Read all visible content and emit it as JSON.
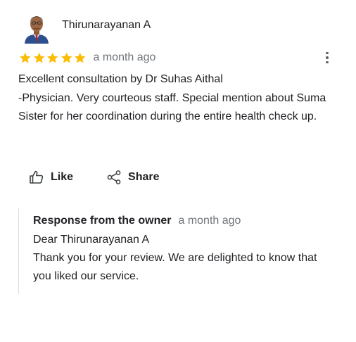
{
  "review": {
    "reviewer_name": "Thirunarayanan A",
    "rating": 5,
    "rating_max": 5,
    "timestamp": "a month ago",
    "text": "Excellent consultation by Dr Suhas Aithal\n-Physician. Very courteous staff. Special mention about Suma Sister for her coordination during the entire health check up.",
    "star_color": "#fbbc04"
  },
  "actions": {
    "like_label": "Like",
    "share_label": "Share"
  },
  "owner_response": {
    "title": "Response from the owner",
    "timestamp": "a month ago",
    "greeting": "Dear Thirunarayanan A",
    "message": "Thank you for your review. We are delighted to know that you liked our service."
  },
  "icons": {
    "avatar": "avatar",
    "star": "star-icon",
    "more": "more-vert-icon",
    "like": "thumb-up-icon",
    "share": "share-icon"
  }
}
